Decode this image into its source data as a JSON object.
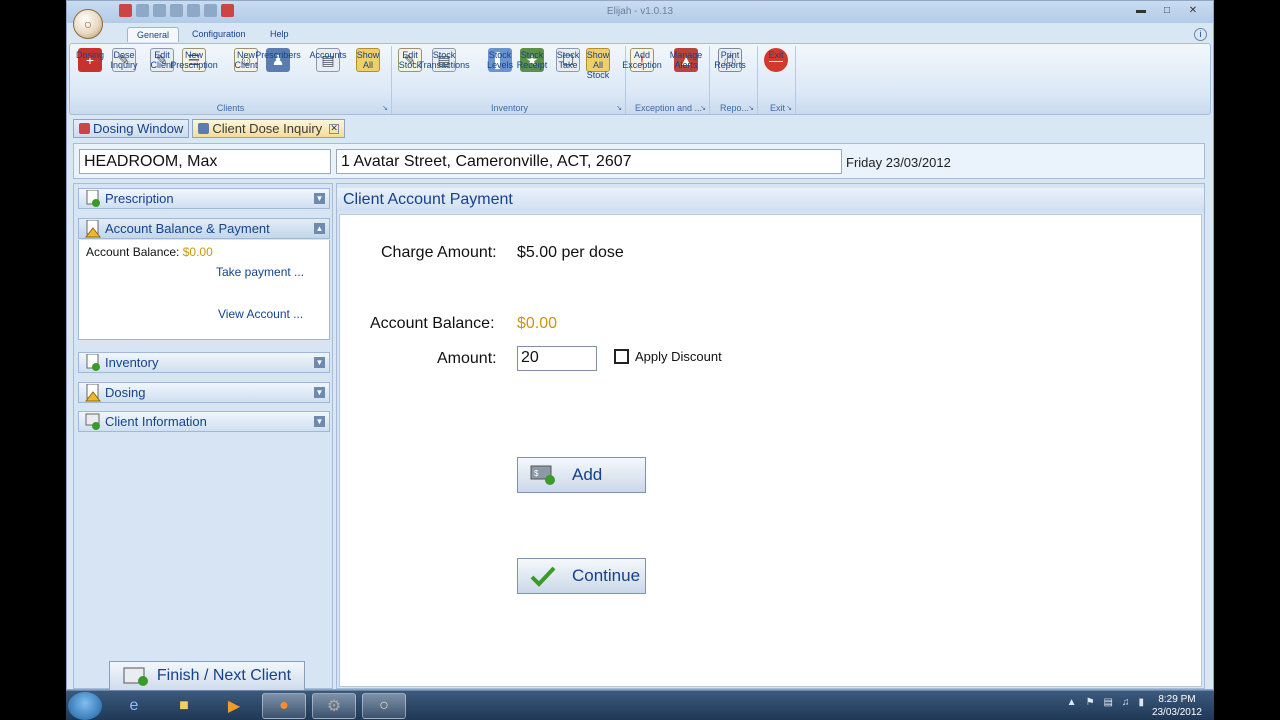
{
  "window": {
    "title": "Elijah - v1.0.13"
  },
  "ribbon": {
    "tabs": [
      "General",
      "Configuration",
      "Help"
    ],
    "groups": {
      "clients": {
        "label": "Clients",
        "buttons": [
          "Dosing",
          "Dose\nInquiry",
          "Edit\nClient",
          "New\nPrescription",
          "New\nClient",
          "Prescribers",
          "Accounts",
          "Show All"
        ]
      },
      "inventory": {
        "label": "Inventory",
        "buttons": [
          "Edit\nStock",
          "Stock\nTransactions",
          "Stock\nLevels",
          "Stock\nReceipt",
          "Stock\nTake",
          "Show All\nStock"
        ]
      },
      "exception": {
        "label": "Exception and ...",
        "buttons": [
          "Add\nException",
          "Manage\nAlerts"
        ]
      },
      "reports": {
        "label": "Repo...",
        "buttons": [
          "Print\nReports"
        ]
      },
      "exit": {
        "label": "Exit",
        "buttons": [
          "Exit"
        ]
      }
    }
  },
  "doc_tabs": [
    "Dosing Window",
    "Client Dose Inquiry"
  ],
  "client": {
    "name": "HEADROOM, Max",
    "address": "1 Avatar Street, Cameronville, ACT, 2607",
    "date": "Friday 23/03/2012"
  },
  "left_panel": {
    "sections": [
      "Prescription",
      "Account Balance & Payment",
      "Inventory",
      "Dosing",
      "Client Information"
    ],
    "account_balance_label": "Account Balance:",
    "account_balance_value": "$0.00",
    "take_payment": "Take payment ...",
    "view_account": "View Account ...",
    "finish_button": "Finish / Next Client"
  },
  "main": {
    "title": "Client Account Payment",
    "charge_label": "Charge Amount:",
    "charge_value": "$5.00 per dose",
    "balance_label": "Account Balance:",
    "balance_value": "$0.00",
    "amount_label": "Amount:",
    "amount_value": "20",
    "apply_discount": "Apply Discount",
    "add_button": "Add",
    "continue_button": "Continue"
  },
  "taskbar": {
    "time": "8:29 PM",
    "date": "23/03/2012"
  },
  "colors": {
    "balance": "#c8960f",
    "ribbon_text": "#15428b"
  }
}
